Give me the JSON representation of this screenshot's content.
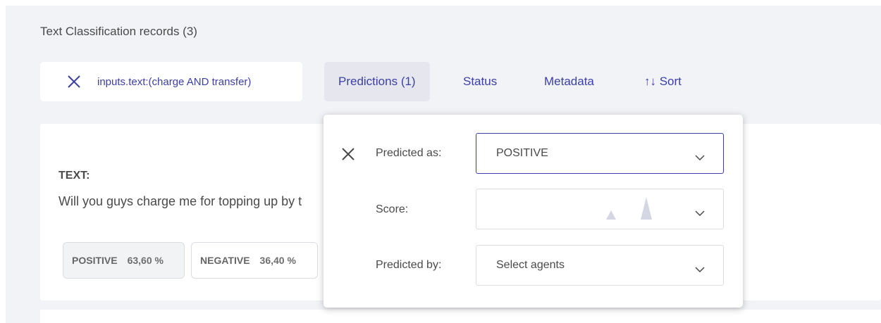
{
  "page": {
    "title": "Text Classification records (3)"
  },
  "search": {
    "query": "inputs.text:(charge AND transfer)"
  },
  "filters": {
    "tabs": [
      {
        "label": "Predictions (1)",
        "active": true
      },
      {
        "label": "Status",
        "active": false
      },
      {
        "label": "Metadata",
        "active": false
      },
      {
        "label": "↑↓ Sort",
        "active": false
      }
    ]
  },
  "record": {
    "text_label": "TEXT:",
    "text_visible": "Will you guys charge me for topping up by t",
    "predictions": [
      {
        "label": "POSITIVE",
        "pct": "63,60 %"
      },
      {
        "label": "NEGATIVE",
        "pct": "36,40 %"
      }
    ]
  },
  "dropdown": {
    "predicted_as": {
      "label": "Predicted as:",
      "value": "POSITIVE"
    },
    "score": {
      "label": "Score:",
      "value": ""
    },
    "predicted_by": {
      "label": "Predicted by:",
      "placeholder": "Select agents"
    }
  },
  "colors": {
    "accent": "#3b3fa6",
    "background": "#f2f3f7",
    "text": "#4a4a4a",
    "histogram": "#d5d6e3"
  },
  "icons": {
    "clear_search": "close-icon",
    "close_panel": "close-icon",
    "select_chevron": "chevron-down-icon"
  }
}
